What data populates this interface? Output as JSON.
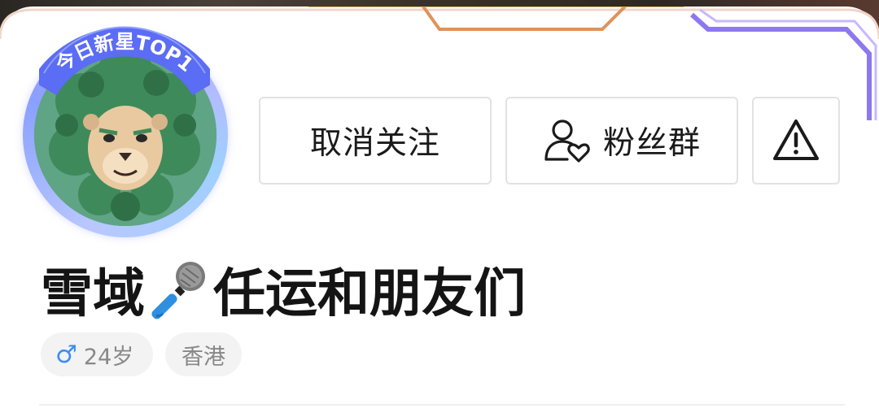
{
  "profile": {
    "badge_text": "今日新星TOP1",
    "name_part1": "雪域",
    "name_part2": "任运和朋友们",
    "tags": {
      "age": "24岁",
      "location": "香港"
    }
  },
  "actions": {
    "unfollow_label": "取消关注",
    "fans_group_label": "粉丝群"
  },
  "colors": {
    "gender_male": "#3c8ef0",
    "badge_blue": "#5b6cf5",
    "frame_orange": "#e0925a",
    "frame_purple": "#8e78f0"
  },
  "icons": {
    "gender": "male-icon",
    "fans_group": "user-heart-icon",
    "report": "warning-triangle-icon",
    "microphone": "microphone-emoji"
  }
}
